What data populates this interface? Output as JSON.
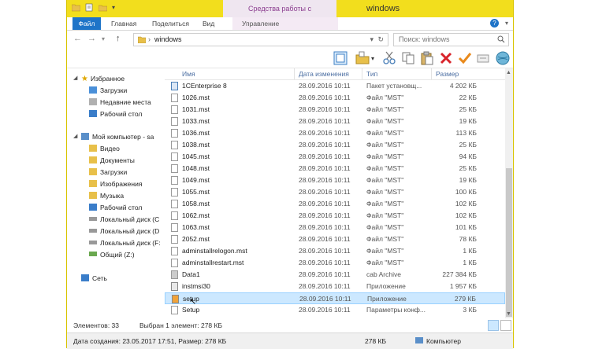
{
  "window": {
    "title": "windows",
    "context_tab_title": "Средства работы с приложениями"
  },
  "ribbon": {
    "tabs": [
      "Файл",
      "Главная",
      "Поделиться",
      "Вид",
      "Управление"
    ]
  },
  "address": {
    "path": "windows",
    "search_placeholder": "Поиск: windows"
  },
  "nav": {
    "favorites": "Избранное",
    "fav_items": [
      "Загрузки",
      "Недавние места",
      "Рабочий стол"
    ],
    "computer": "Мой компьютер - sa",
    "comp_items": [
      "Видео",
      "Документы",
      "Загрузки",
      "Изображения",
      "Музыка",
      "Рабочий стол",
      "Локальный диск (C",
      "Локальный диск (D",
      "Локальный диск (F:",
      "Общий (Z:)"
    ],
    "network": "Сеть"
  },
  "columns": [
    "Имя",
    "Дата изменения",
    "Тип",
    "Размер"
  ],
  "files": [
    {
      "name": "1CEnterprise 8",
      "date": "28.09.2016 10:11",
      "type": "Пакет установщ...",
      "size": "4 202 КБ"
    },
    {
      "name": "1026.mst",
      "date": "28.09.2016 10:11",
      "type": "Файл \"MST\"",
      "size": "22 КБ"
    },
    {
      "name": "1031.mst",
      "date": "28.09.2016 10:11",
      "type": "Файл \"MST\"",
      "size": "25 КБ"
    },
    {
      "name": "1033.mst",
      "date": "28.09.2016 10:11",
      "type": "Файл \"MST\"",
      "size": "19 КБ"
    },
    {
      "name": "1036.mst",
      "date": "28.09.2016 10:11",
      "type": "Файл \"MST\"",
      "size": "113 КБ"
    },
    {
      "name": "1038.mst",
      "date": "28.09.2016 10:11",
      "type": "Файл \"MST\"",
      "size": "25 КБ"
    },
    {
      "name": "1045.mst",
      "date": "28.09.2016 10:11",
      "type": "Файл \"MST\"",
      "size": "94 КБ"
    },
    {
      "name": "1048.mst",
      "date": "28.09.2016 10:11",
      "type": "Файл \"MST\"",
      "size": "25 КБ"
    },
    {
      "name": "1049.mst",
      "date": "28.09.2016 10:11",
      "type": "Файл \"MST\"",
      "size": "19 КБ"
    },
    {
      "name": "1055.mst",
      "date": "28.09.2016 10:11",
      "type": "Файл \"MST\"",
      "size": "100 КБ"
    },
    {
      "name": "1058.mst",
      "date": "28.09.2016 10:11",
      "type": "Файл \"MST\"",
      "size": "102 КБ"
    },
    {
      "name": "1062.mst",
      "date": "28.09.2016 10:11",
      "type": "Файл \"MST\"",
      "size": "102 КБ"
    },
    {
      "name": "1063.mst",
      "date": "28.09.2016 10:11",
      "type": "Файл \"MST\"",
      "size": "101 КБ"
    },
    {
      "name": "2052.mst",
      "date": "28.09.2016 10:11",
      "type": "Файл \"MST\"",
      "size": "78 КБ"
    },
    {
      "name": "adminstallrelogon.mst",
      "date": "28.09.2016 10:11",
      "type": "Файл \"MST\"",
      "size": "1 КБ"
    },
    {
      "name": "adminstallrestart.mst",
      "date": "28.09.2016 10:11",
      "type": "Файл \"MST\"",
      "size": "1 КБ"
    },
    {
      "name": "Data1",
      "date": "28.09.2016 10:11",
      "type": "cab Archive",
      "size": "227 384 КБ"
    },
    {
      "name": "instmsi30",
      "date": "28.09.2016 10:11",
      "type": "Приложение",
      "size": "1 957 КБ"
    },
    {
      "name": "setup",
      "date": "28.09.2016 10:11",
      "type": "Приложение",
      "size": "279 КБ",
      "selected": true
    },
    {
      "name": "Setup",
      "date": "28.09.2016 10:11",
      "type": "Параметры конф...",
      "size": "3 КБ"
    }
  ],
  "status": {
    "count": "Элементов: 33",
    "selected": "Выбран 1 элемент: 278 КБ"
  },
  "info": {
    "details": "Дата создания: 23.05.2017 17:51, Размер: 278 КБ",
    "size": "278 КБ",
    "location": "Компьютер"
  },
  "colors": {
    "title_bar": "#f2de1d",
    "context_tab": "#8b3d8f",
    "file_tab": "#1e74c8",
    "selection": "#cce8ff"
  }
}
